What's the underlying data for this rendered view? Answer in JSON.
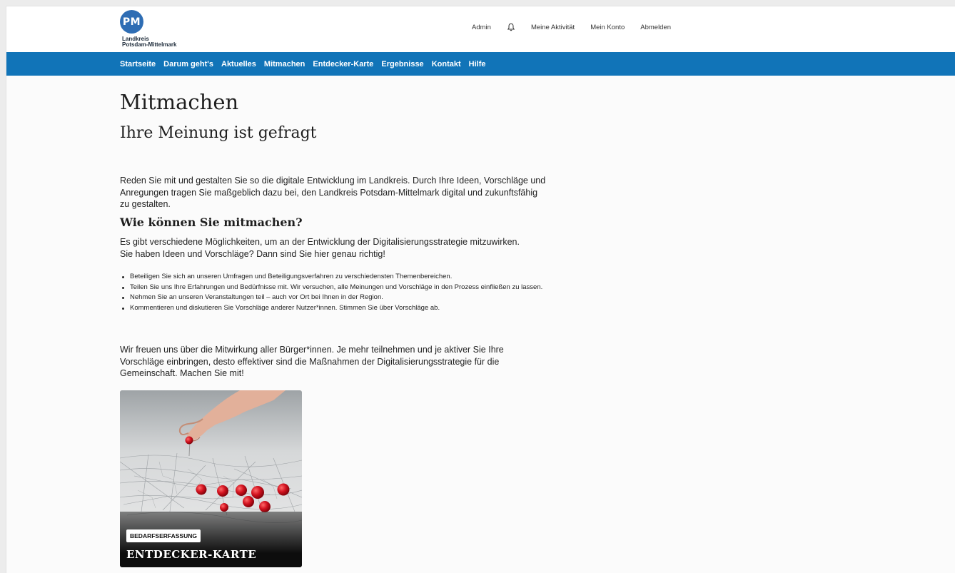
{
  "header": {
    "logo": {
      "initials": "PM",
      "line1": "Landkreis",
      "line2": "Potsdam-Mittelmark"
    },
    "top_links": {
      "admin": "Admin",
      "activity": "Meine Aktivität",
      "account": "Mein Konto",
      "logout": "Abmelden"
    },
    "bell_icon": "bell-icon"
  },
  "nav": {
    "items": [
      "Startseite",
      "Darum geht's",
      "Aktuelles",
      "Mitmachen",
      "Entdecker-Karte",
      "Ergebnisse",
      "Kontakt",
      "Hilfe"
    ]
  },
  "main": {
    "title": "Mitmachen",
    "subtitle": "Ihre Meinung ist gefragt",
    "intro": "Reden Sie mit und gestalten Sie so die digitale Entwicklung im Landkreis. Durch Ihre Ideen, Vorschläge und Anregungen tragen Sie maßgeblich dazu bei, den Landkreis Potsdam-Mittelmark digital und zukunftsfähig zu gestalten.",
    "section_title": "Wie können Sie mitmachen?",
    "section_text": "Es gibt verschiedene Möglichkeiten, um an der Entwicklung der Digitalisierungsstrategie mitzuwirken. Sie haben Ideen und Vorschläge? Dann sind Sie hier genau richtig!",
    "bullets": [
      "Beteiligen Sie sich an unseren Umfragen und Beteiligungsverfahren zu verschiedensten Themenbereichen.",
      "Teilen Sie uns Ihre Erfahrungen und Bedürfnisse mit. Wir versuchen, alle Meinungen und Vorschläge in den Prozess einfließen zu lassen.",
      "Nehmen Sie an unseren Veranstaltungen teil – auch vor Ort bei Ihnen in der Region.",
      "Kommentieren und diskutieren Sie Vorschläge anderer Nutzer*innen. Stimmen Sie über Vorschläge ab."
    ],
    "outro": "Wir freuen uns über die Mitwirkung aller Bürger*innen. Je mehr teilnehmen und je aktiver Sie Ihre Vorschläge einbringen, desto effektiver sind die Maßnahmen der Digitalisierungsstrategie für die Gemeinschaft. Machen Sie mit!",
    "card": {
      "badge": "BEDARFSERFASSUNG",
      "title": "ENTDECKER-KARTE"
    }
  },
  "colors": {
    "nav_bg": "#1174b8",
    "logo_blue": "#2e6db4",
    "pin_red": "#d2121f"
  }
}
